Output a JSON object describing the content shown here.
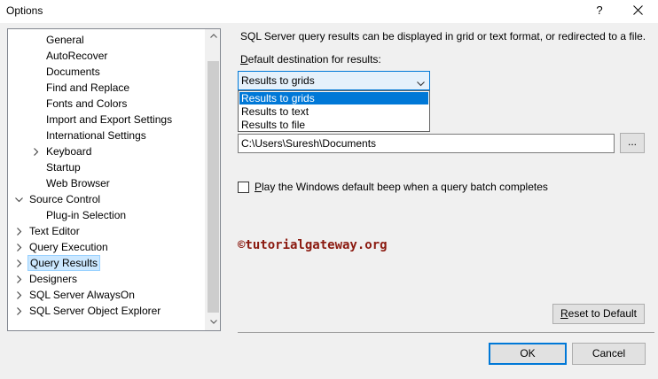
{
  "window": {
    "title": "Options",
    "help_label": "?",
    "close_icon": "close-icon"
  },
  "tree": {
    "items": [
      {
        "label": "General",
        "expander": "none",
        "selected": false
      },
      {
        "label": "AutoRecover",
        "expander": "none",
        "selected": false
      },
      {
        "label": "Documents",
        "expander": "none",
        "selected": false
      },
      {
        "label": "Find and Replace",
        "expander": "none",
        "selected": false
      },
      {
        "label": "Fonts and Colors",
        "expander": "none",
        "selected": false
      },
      {
        "label": "Import and Export Settings",
        "expander": "none",
        "selected": false
      },
      {
        "label": "International Settings",
        "expander": "none",
        "selected": false
      },
      {
        "label": "Keyboard",
        "expander": "collapsed",
        "selected": false
      },
      {
        "label": "Startup",
        "expander": "none",
        "selected": false
      },
      {
        "label": "Web Browser",
        "expander": "none",
        "selected": false
      },
      {
        "label": "Source Control",
        "expander": "expanded",
        "selected": false
      },
      {
        "label": "Plug-in Selection",
        "expander": "none",
        "selected": false
      },
      {
        "label": "Text Editor",
        "expander": "collapsed",
        "selected": false
      },
      {
        "label": "Query Execution",
        "expander": "collapsed",
        "selected": false
      },
      {
        "label": "Query Results",
        "expander": "collapsed",
        "selected": true
      },
      {
        "label": "Designers",
        "expander": "collapsed",
        "selected": false
      },
      {
        "label": "SQL Server AlwaysOn",
        "expander": "collapsed",
        "selected": false
      },
      {
        "label": "SQL Server Object Explorer",
        "expander": "collapsed",
        "selected": false
      }
    ]
  },
  "panel": {
    "description": "SQL Server query results can be displayed in grid or text format, or redirected to a file.",
    "destination_label_prefix": "",
    "destination_label_accel": "D",
    "destination_label_rest": "efault destination for results:",
    "destination_value": "Results to grids",
    "destination_options": [
      "Results to grids",
      "Results to text",
      "Results to file"
    ],
    "selected_option": "Results to grids",
    "file_location": "C:\\Users\\Suresh\\Documents",
    "browse_label": "...",
    "beep_accel": "P",
    "beep_label_rest": "lay the Windows default beep when a query batch completes",
    "beep_checked": false,
    "watermark": "©tutorialgateway.org",
    "reset_accel": "R",
    "reset_label_rest": "eset to Default"
  },
  "footer": {
    "ok_label": "OK",
    "cancel_label": "Cancel"
  },
  "colors": {
    "selection_bg": "#cce8ff",
    "accent": "#0078d7",
    "watermark": "#8b1a10"
  }
}
